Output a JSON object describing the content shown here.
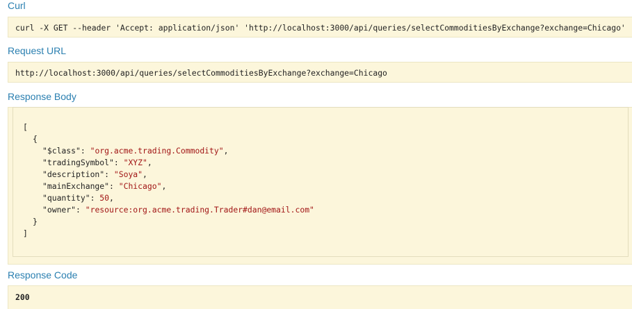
{
  "curl": {
    "heading": "Curl",
    "command": "curl -X GET --header 'Accept: application/json' 'http://localhost:3000/api/queries/selectCommoditiesByExchange?exchange=Chicago'"
  },
  "request_url": {
    "heading": "Request URL",
    "url": "http://localhost:3000/api/queries/selectCommoditiesByExchange?exchange=Chicago"
  },
  "response_body": {
    "heading": "Response Body",
    "open_bracket": "[",
    "open_brace": "{",
    "fields": [
      {
        "key": "\"$class\"",
        "sep": ": ",
        "value": "\"org.acme.trading.Commodity\"",
        "tail": ","
      },
      {
        "key": "\"tradingSymbol\"",
        "sep": ": ",
        "value": "\"XYZ\"",
        "tail": ","
      },
      {
        "key": "\"description\"",
        "sep": ": ",
        "value": "\"Soya\"",
        "tail": ","
      },
      {
        "key": "\"mainExchange\"",
        "sep": ": ",
        "value": "\"Chicago\"",
        "tail": ","
      },
      {
        "key": "\"quantity\"",
        "sep": ": ",
        "value": "50",
        "tail": ","
      },
      {
        "key": "\"owner\"",
        "sep": ": ",
        "value": "\"resource:org.acme.trading.Trader#dan@email.com\"",
        "tail": ""
      }
    ],
    "close_brace": "}",
    "close_bracket": "]"
  },
  "response_code": {
    "heading": "Response Code",
    "code": "200"
  },
  "colors": {
    "heading": "#2a7fb0",
    "box_background": "#fcf6db",
    "string_value": "#a11515"
  }
}
